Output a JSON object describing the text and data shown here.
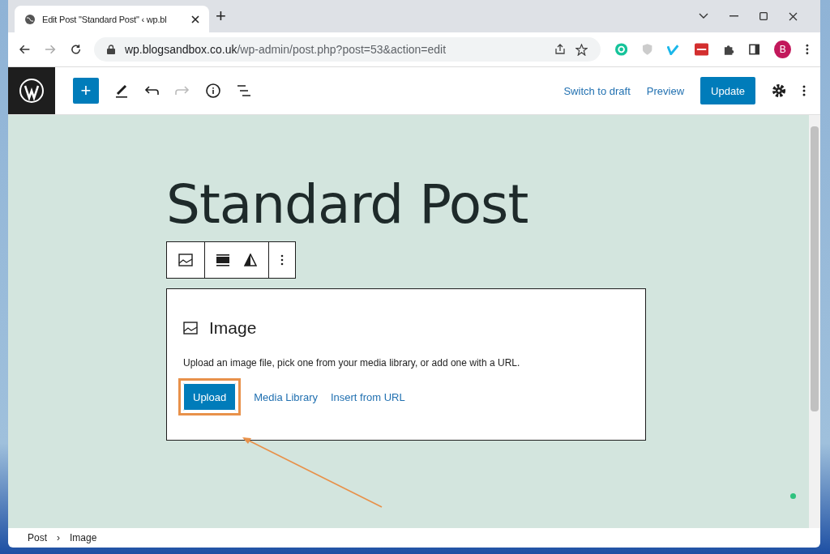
{
  "browser": {
    "tab_title": "Edit Post \"Standard Post\" ‹ wp.bl",
    "new_tab": "+",
    "url_host": "wp.blogsandbox.co.uk",
    "url_path": "/wp-admin/post.php?post=53&action=edit",
    "profile_initial": "B"
  },
  "toolbar": {
    "add": "+",
    "switch_to_draft": "Switch to draft",
    "preview": "Preview",
    "update": "Update"
  },
  "post": {
    "title": "Standard Post"
  },
  "image_block": {
    "heading": "Image",
    "description": "Upload an image file, pick one from your media library, or add one with a URL.",
    "upload": "Upload",
    "media_library": "Media Library",
    "insert_from_url": "Insert from URL",
    "upload_highlighted": true
  },
  "breadcrumbs": [
    {
      "label": "Post"
    },
    {
      "label": "Image"
    }
  ],
  "breadcrumb_separator": "›"
}
